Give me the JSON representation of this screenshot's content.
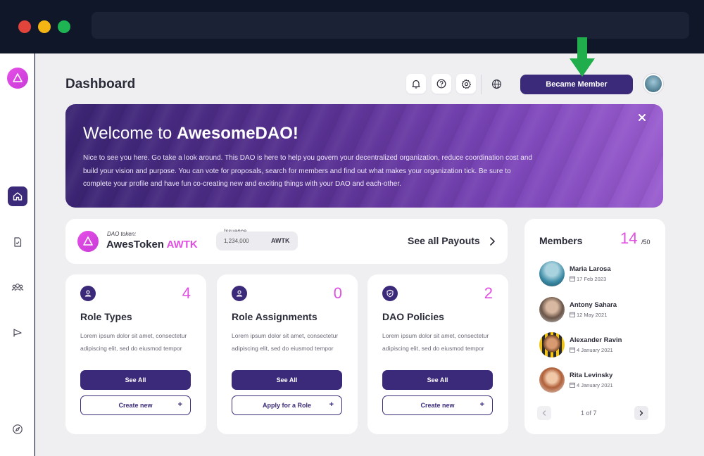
{
  "page": {
    "title": "Dashboard"
  },
  "header": {
    "member_button": "Became Member"
  },
  "banner": {
    "title_prefix": "Welcome to ",
    "title_name": "AwesomeDAO!",
    "text": "Nice to see you here. Go take a look around. This DAO is here to help you govern your decentralized organization, reduce coordination cost and build your vision and purpose. You can vote for proposals, search for members and find out what makes your organization tick. Be sure to complete your profile and have fun co-creating new and exciting things with your DAO and each-other."
  },
  "token": {
    "label": "DAO token:",
    "name": "AwesToken",
    "symbol": "AWTK",
    "issuance_label": "Issuance",
    "issuance_value": "1,234,000",
    "issuance_unit": "AWTK",
    "payouts_link": "See all Payouts"
  },
  "cards": [
    {
      "title": "Role Types",
      "count": "4",
      "desc": "Lorem ipsum dolor sit amet, consectetur adipiscing elit, sed do eiusmod tempor",
      "primary": "See All",
      "secondary": "Create new"
    },
    {
      "title": "Role Assignments",
      "count": "0",
      "desc": "Lorem ipsum dolor sit amet, consectetur adipiscing elit, sed do eiusmod tempor",
      "primary": "See All",
      "secondary": "Apply for a Role"
    },
    {
      "title": "DAO Policies",
      "count": "2",
      "desc": "Lorem ipsum dolor sit amet, consectetur adipiscing elit, sed do eiusmod tempor",
      "primary": "See All",
      "secondary": "Create new"
    }
  ],
  "members": {
    "title": "Members",
    "count": "14",
    "total": "/50",
    "list": [
      {
        "name": "Maria Larosa",
        "date": "17 Feb 2023"
      },
      {
        "name": "Antony Sahara",
        "date": "12 May 2021"
      },
      {
        "name": "Alexander Ravin",
        "date": "4 January 2021"
      },
      {
        "name": "Rita Levinsky",
        "date": "4 January 2021"
      }
    ],
    "pager": "1 of 7"
  },
  "colors": {
    "accent": "#e04fe2",
    "primary": "#3b2a7a",
    "arrow": "#1fae4b"
  },
  "icons": [
    "bell-icon",
    "help-icon",
    "gear-icon",
    "globe-icon",
    "home-icon",
    "document-icon",
    "people-icon",
    "flag-icon",
    "compass-icon",
    "close-icon",
    "chevron-right-icon",
    "chevron-left-icon",
    "calendar-icon",
    "plus-icon"
  ]
}
